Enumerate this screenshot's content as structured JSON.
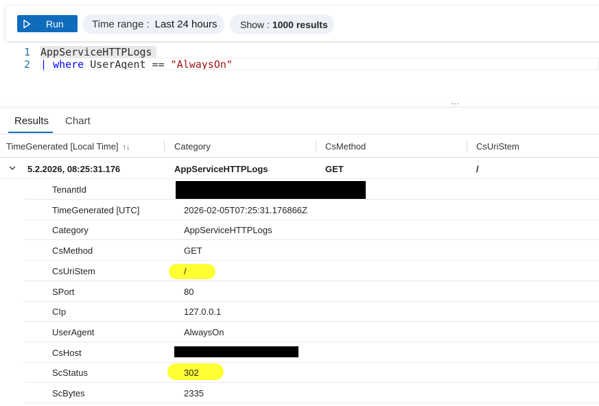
{
  "toolbar": {
    "run_label": "Run",
    "time_range_key": "Time range :",
    "time_range_value": "Last 24 hours",
    "show_key": "Show :",
    "show_value": "1000 results"
  },
  "editor": {
    "line1_number": "1",
    "line2_number": "2",
    "line1_code": "AppServiceHTTPLogs",
    "line2_pipe": "|",
    "line2_keyword": "where",
    "line2_field": " UserAgent == ",
    "line2_string": "\"AlwaysOn\"",
    "splitter_dots": "..."
  },
  "tabs": {
    "results": "Results",
    "chart": "Chart"
  },
  "table": {
    "headers": [
      "TimeGenerated [Local Time]",
      "Category",
      "CsMethod",
      "CsUriStem"
    ],
    "sort_icon": "↑↓",
    "group_row": {
      "time": "5.2.2026, 08:25:31.176",
      "category": "AppServiceHTTPLogs",
      "method": "GET",
      "uri": "/"
    },
    "details": [
      {
        "key": "TenantId",
        "value": ""
      },
      {
        "key": "TimeGenerated [UTC]",
        "value": "2026-02-05T07:25:31.176866Z"
      },
      {
        "key": "Category",
        "value": "AppServiceHTTPLogs"
      },
      {
        "key": "CsMethod",
        "value": "GET"
      },
      {
        "key": "CsUriStem",
        "value": "/"
      },
      {
        "key": "SPort",
        "value": "80"
      },
      {
        "key": "CIp",
        "value": "127.0.0.1"
      },
      {
        "key": "UserAgent",
        "value": "AlwaysOn"
      },
      {
        "key": "CsHost",
        "value": ""
      },
      {
        "key": "ScStatus",
        "value": "302"
      },
      {
        "key": "ScBytes",
        "value": "2335"
      }
    ]
  },
  "icons": {
    "run": "play-icon",
    "sort": "sort-icon",
    "expand": "chevron-down-icon"
  },
  "colors": {
    "accent": "#0f6cbd",
    "highlight": "#ffff33",
    "redaction": "#000000",
    "keyword": "#0000ff",
    "string": "#a31515"
  }
}
